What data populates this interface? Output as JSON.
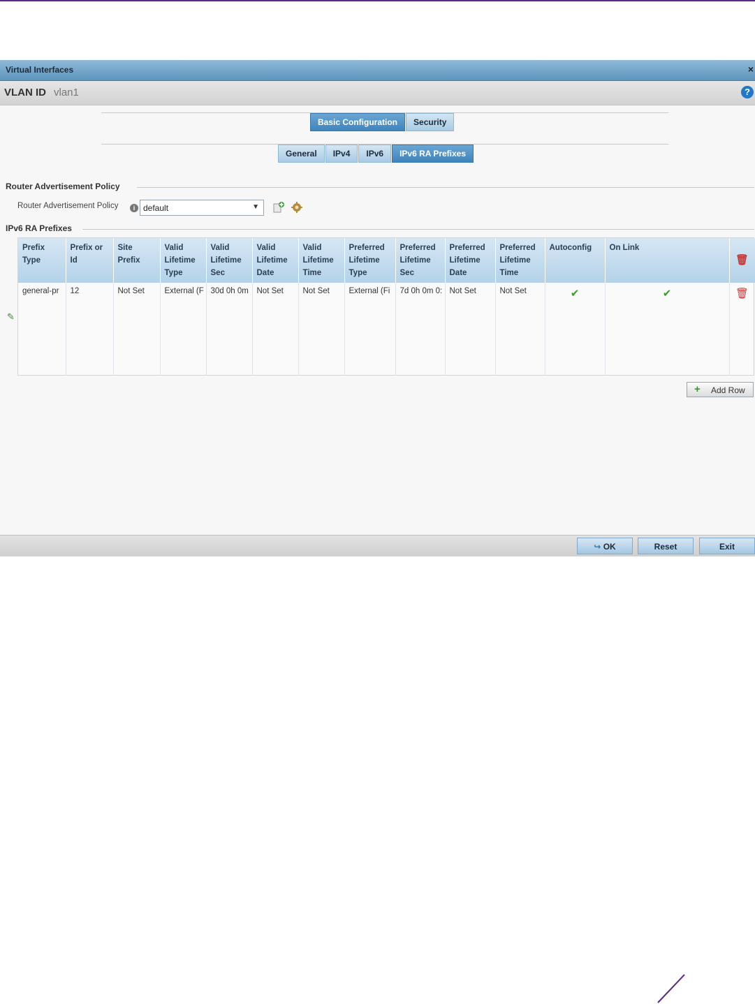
{
  "dialog": {
    "title": "Virtual Interfaces",
    "close_glyph": "×",
    "id_label": "VLAN ID",
    "id_value": "vlan1",
    "help_glyph": "?"
  },
  "tabs": {
    "primary": [
      {
        "label": "Basic Configuration",
        "active": true
      },
      {
        "label": "Security",
        "active": false
      }
    ],
    "secondary": [
      {
        "label": "General",
        "active": false
      },
      {
        "label": "IPv4",
        "active": false
      },
      {
        "label": "IPv6",
        "active": false
      },
      {
        "label": "IPv6 RA Prefixes",
        "active": true
      }
    ]
  },
  "router_policy": {
    "section_title": "Router Advertisement Policy",
    "field_label": "Router Advertisement Policy",
    "selected": "default",
    "icons": [
      "create-policy-icon",
      "edit-policy-icon"
    ]
  },
  "prefixes": {
    "section_title": "IPv6 RA Prefixes",
    "columns": [
      "Prefix Type",
      "Prefix or Id",
      "Site Prefix",
      "Valid Lifetime Type",
      "Valid Lifetime Sec",
      "Valid Lifetime Date",
      "Valid Lifetime Time",
      "Preferred Lifetime Type",
      "Preferred Lifetime Sec",
      "Preferred Lifetime Date",
      "Preferred Lifetime Time",
      "Autoconfig",
      "On Link"
    ],
    "rows": [
      {
        "cells": [
          "general-pr",
          "12",
          "Not Set",
          "External (F",
          "30d 0h 0m",
          "Not Set",
          "Not Set",
          "External (Fi",
          "7d 0h 0m 0:",
          "Not Set",
          "Not Set"
        ],
        "autoconfig": true,
        "on_link": true
      }
    ],
    "add_row_label": "Add Row"
  },
  "footer": {
    "ok_label": "OK",
    "reset_label": "Reset",
    "exit_label": "Exit"
  },
  "colors": {
    "brand_rule": "#5b2a86",
    "active_tab": "#3f84bd",
    "check": "#3a9c2a",
    "delete": "#c23a3a"
  }
}
